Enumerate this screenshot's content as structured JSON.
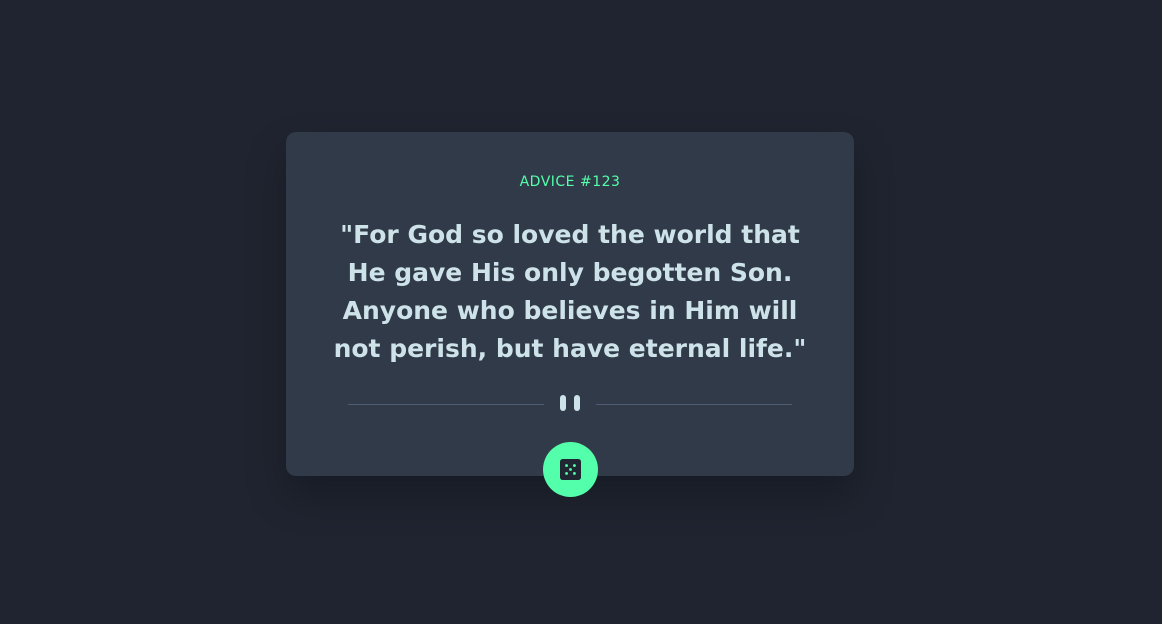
{
  "advice": {
    "id_label": "ADVICE #123",
    "text": "\"For God so loved the world that He gave His only begotten Son. Anyone who believes in Him will not perish, but have eternal life.\""
  },
  "divider": {
    "icon": "pause-icon"
  },
  "button": {
    "icon": "dice-icon"
  },
  "colors": {
    "background": "#1f2430",
    "card": "#313a48",
    "accent": "#53ffaa",
    "text": "#cee3e9",
    "divider_line": "#4f5d74"
  }
}
